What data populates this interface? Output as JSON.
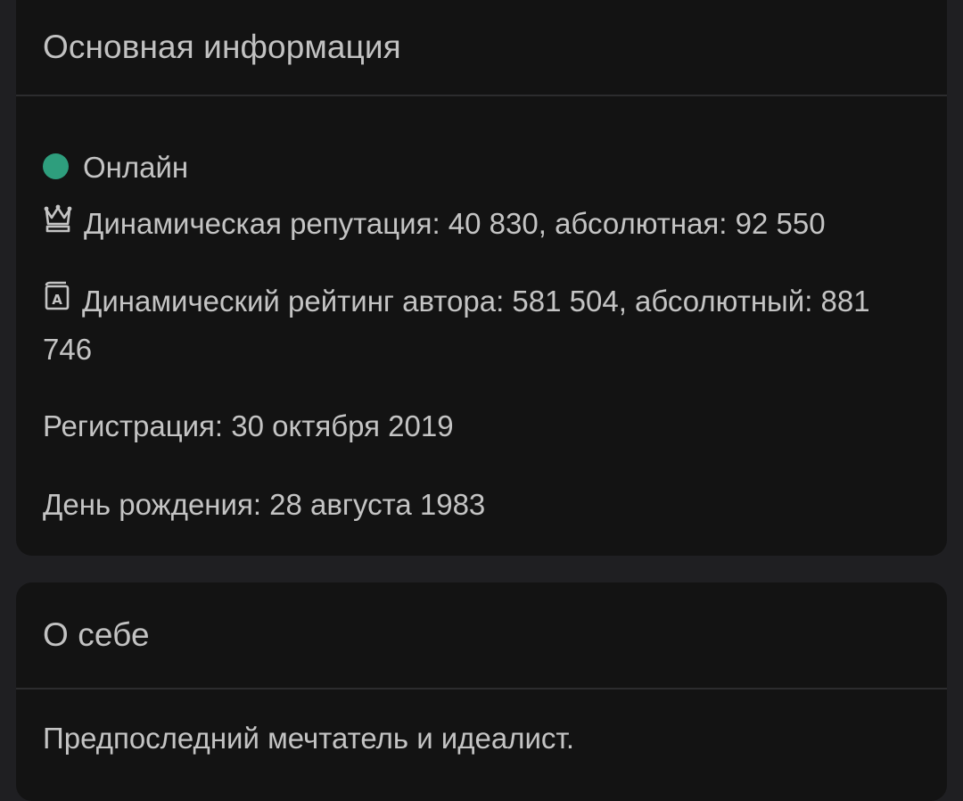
{
  "main_card": {
    "title": "Основная информация",
    "status": {
      "label": "Онлайн",
      "color": "#2e9e7d"
    },
    "reputation": {
      "icon": "crown-icon",
      "text": "Динамическая репутация: 40 830, абсолютная: 92 550"
    },
    "author_rating": {
      "icon": "book-icon",
      "text": "Динамический рейтинг автора: 581 504, абсолютный: 881 746"
    },
    "registration": "Регистрация: 30 октября 2019",
    "birthday": "День рождения: 28 августа 1983"
  },
  "about_card": {
    "title": "О себе",
    "text": "Предпоследний мечтатель и идеалист."
  }
}
